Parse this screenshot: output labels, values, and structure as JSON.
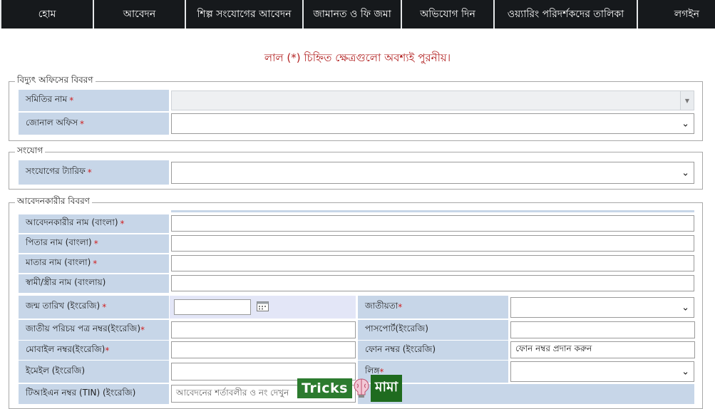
{
  "nav": {
    "items": [
      "হোম",
      "আবেদন",
      "শিল্প সংযোগের আবেদন",
      "জামানত ও ফি জমা",
      "অভিযোগ দিন",
      "ওয়্যারিং পরিদর্শকদের তালিকা",
      "লগইন"
    ]
  },
  "notice": {
    "before": "লাল (",
    "star": "*",
    "after": ") চিহ্নিত ক্ষেত্রগুলো অবশ্যই পুরনীয়।"
  },
  "office": {
    "legend": "বিদ্যুৎ অফিসের বিবরণ",
    "samity_label": "সমিতির নাম",
    "zonal_label": "জোনাল অফিস"
  },
  "connection": {
    "legend": "সংযোগ",
    "tariff_label": "সংযোগের ট্যারিফ"
  },
  "applicant": {
    "legend": "আবেদনকারীর বিবরণ",
    "name_label": "আবেদনকারীর নাম (বাংলা)",
    "father_label": "পিতার নাম (বাংলা)",
    "mother_label": "মাতার নাম (বাংলা)",
    "spouse_label": "স্বামী/স্ত্রীর নাম (বাংলায়)",
    "dob_label": "জন্ম তারিখ (ইংরেজি)",
    "nationality_label": "জাতীয়তা",
    "nid_label": "জাতীয় পরিচয় পত্র নম্বর(ইংরেজি)",
    "passport_label": "পাসপোর্ট(ইংরেজি)",
    "mobile_label": "মোবাইল নম্বর(ইংরেজি)",
    "phone_label": "ফোন নম্বর (ইংরেজি)",
    "phone_placeholder": "ফোন নম্বর প্রদান করুন",
    "email_label": "ইমেইল (ইংরেজি)",
    "gender_label": "লিঙ্গ",
    "tin_label": "টিআইএন নম্বর (TIN) (ইংরেজি)",
    "tin_value": "আবেদনের শর্তাবলীর ও নং দেখুন"
  },
  "required_mark": "*",
  "watermark": {
    "left": "Tricks",
    "right": "মামা"
  },
  "colors": {
    "nav_bg": "#16191c",
    "label_bg": "#c7d6e8",
    "required": "#d02020",
    "notice": "#b22222"
  }
}
